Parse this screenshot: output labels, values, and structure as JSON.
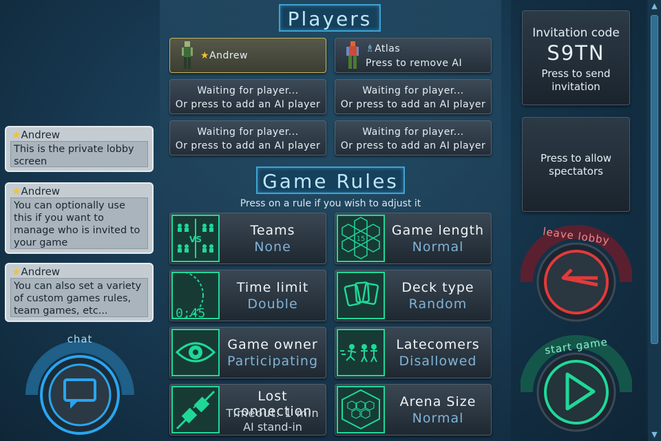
{
  "players_header": "Players",
  "players": [
    {
      "name": "Andrew",
      "own": true
    },
    {
      "name": "Atlas",
      "subtitle": "Press to remove AI"
    },
    {
      "line1": "Waiting for player...",
      "line2": "Or press to add an AI player"
    },
    {
      "line1": "Waiting for player...",
      "line2": "Or press to add an AI player"
    },
    {
      "line1": "Waiting for player...",
      "line2": "Or press to add an AI player"
    },
    {
      "line1": "Waiting for player...",
      "line2": "Or press to add an AI player"
    }
  ],
  "rules_header": "Game Rules",
  "rules_hint": "Press on a rule if you wish to adjust it",
  "rules": [
    {
      "title": "Teams",
      "value": "None",
      "icon": "teams-vs-icon"
    },
    {
      "title": "Game length",
      "value": "Normal",
      "icon": "hex-grid-icon",
      "icon_number": "15"
    },
    {
      "title": "Time limit",
      "value": "Double",
      "icon": "timer-icon",
      "icon_text": "0:45"
    },
    {
      "title": "Deck type",
      "value": "Random",
      "icon": "cards-icon"
    },
    {
      "title": "Game owner",
      "value": "Participating",
      "icon": "eye-icon"
    },
    {
      "title": "Latecomers",
      "value": "Disallowed",
      "icon": "latecomers-icon"
    },
    {
      "title": "Lost connection",
      "value": "Timeout: 1 min",
      "value2": "AI stand-in",
      "icon": "plug-icon"
    },
    {
      "title": "Arena Size",
      "value": "Normal",
      "icon": "arena-hex-icon"
    }
  ],
  "chat_messages": [
    {
      "author": "Andrew",
      "text": "This is the private lobby screen"
    },
    {
      "author": "Andrew",
      "text": "You can optionally use this if you want to manage who is invited to your game"
    },
    {
      "author": "Andrew",
      "text": "You can also set a variety of custom games rules, team games, etc..."
    }
  ],
  "chat_label": "chat",
  "invitation": {
    "label": "Invitation code",
    "code": "S9TN",
    "action": "Press to send invitation"
  },
  "spectators": "Press to allow spectators",
  "leave_label": "leave lobby",
  "start_label": "start game",
  "colors": {
    "accent_green": "#1fd898",
    "header_blue": "#3ca4d3",
    "leave_red": "#e23a3a",
    "chat_blue": "#2aa5f0"
  }
}
